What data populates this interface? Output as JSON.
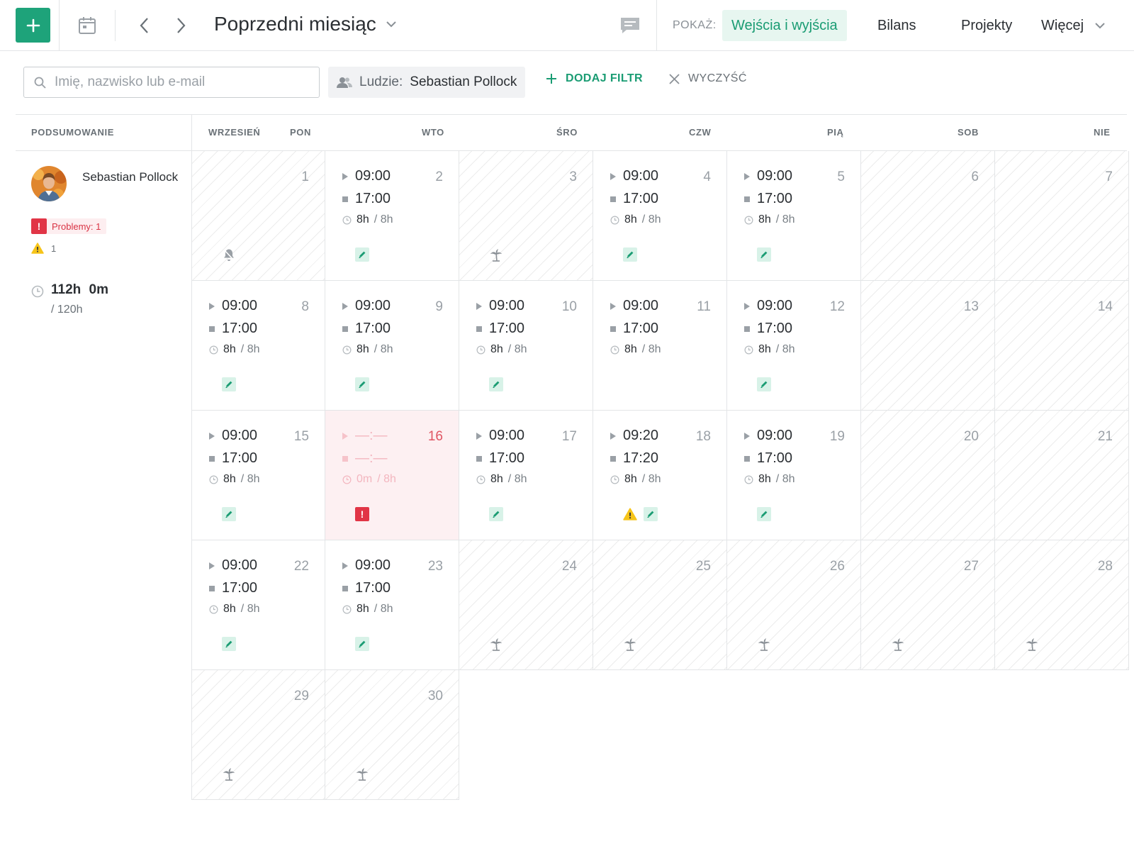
{
  "toolbar": {
    "period_label": "Poprzedni miesiąc",
    "show_label": "POKAŻ:",
    "views": [
      {
        "label": "Wejścia i wyjścia",
        "active": true
      },
      {
        "label": "Bilans",
        "active": false
      },
      {
        "label": "Projekty",
        "active": false
      }
    ],
    "more_label": "Więcej",
    "accent_color": "#1ea37a"
  },
  "filters": {
    "search_placeholder": "Imię, nazwisko lub e-mail",
    "people_label": "Ludzie:",
    "people_value": "Sebastian Pollock",
    "add_filter_label": "DODAJ FILTR",
    "clear_label": "WYCZYŚĆ"
  },
  "calendar": {
    "summary_header": "PODSUMOWANIE",
    "month_label": "WRZESIEŃ",
    "weekdays": [
      "PON",
      "WTO",
      "ŚRO",
      "CZW",
      "PIĄ",
      "SOB",
      "NIE"
    ]
  },
  "summary": {
    "user_name": "Sebastian Pollock",
    "problems_label": "Problemy: 1",
    "warnings_count": "1",
    "total_hours": "112h 0m",
    "required_hours": "/ 120h"
  },
  "days": [
    {
      "num": "1",
      "off": true,
      "icon": "bell-off-icon"
    },
    {
      "num": "2",
      "in": "09:00",
      "out": "17:00",
      "worked": "8h",
      "required": "/ 8h",
      "edit": true
    },
    {
      "num": "3",
      "off": true,
      "icon": "palm-tree-icon"
    },
    {
      "num": "4",
      "in": "09:00",
      "out": "17:00",
      "worked": "8h",
      "required": "/ 8h",
      "edit": true
    },
    {
      "num": "5",
      "in": "09:00",
      "out": "17:00",
      "worked": "8h",
      "required": "/ 8h",
      "edit": true
    },
    {
      "num": "6",
      "off": true
    },
    {
      "num": "7",
      "off": true
    },
    {
      "num": "8",
      "in": "09:00",
      "out": "17:00",
      "worked": "8h",
      "required": "/ 8h",
      "edit": true
    },
    {
      "num": "9",
      "in": "09:00",
      "out": "17:00",
      "worked": "8h",
      "required": "/ 8h",
      "edit": true
    },
    {
      "num": "10",
      "in": "09:00",
      "out": "17:00",
      "worked": "8h",
      "required": "/ 8h",
      "edit": true
    },
    {
      "num": "11",
      "in": "09:00",
      "out": "17:00",
      "worked": "8h",
      "required": "/ 8h"
    },
    {
      "num": "12",
      "in": "09:00",
      "out": "17:00",
      "worked": "8h",
      "required": "/ 8h",
      "edit": true
    },
    {
      "num": "13",
      "off": true
    },
    {
      "num": "14",
      "off": true
    },
    {
      "num": "15",
      "in": "09:00",
      "out": "17:00",
      "worked": "8h",
      "required": "/ 8h",
      "edit": true
    },
    {
      "num": "16",
      "problem": true,
      "in": "—:—",
      "out": "—:—",
      "worked": "0m",
      "required": "/ 8h"
    },
    {
      "num": "17",
      "in": "09:00",
      "out": "17:00",
      "worked": "8h",
      "required": "/ 8h",
      "edit": true
    },
    {
      "num": "18",
      "in": "09:20",
      "out": "17:20",
      "worked": "8h",
      "required": "/ 8h",
      "edit": true,
      "warning": true
    },
    {
      "num": "19",
      "in": "09:00",
      "out": "17:00",
      "worked": "8h",
      "required": "/ 8h",
      "edit": true
    },
    {
      "num": "20",
      "off": true
    },
    {
      "num": "21",
      "off": true
    },
    {
      "num": "22",
      "in": "09:00",
      "out": "17:00",
      "worked": "8h",
      "required": "/ 8h",
      "edit": true
    },
    {
      "num": "23",
      "in": "09:00",
      "out": "17:00",
      "worked": "8h",
      "required": "/ 8h",
      "edit": true
    },
    {
      "num": "24",
      "off": true,
      "icon": "palm-tree-icon"
    },
    {
      "num": "25",
      "off": true,
      "icon": "palm-tree-icon"
    },
    {
      "num": "26",
      "off": true,
      "icon": "palm-tree-icon"
    },
    {
      "num": "27",
      "off": true,
      "icon": "palm-tree-icon"
    },
    {
      "num": "28",
      "off": true,
      "icon": "palm-tree-icon"
    },
    {
      "num": "29",
      "off": true,
      "icon": "palm-tree-icon"
    },
    {
      "num": "30",
      "off": true,
      "icon": "palm-tree-icon"
    }
  ]
}
